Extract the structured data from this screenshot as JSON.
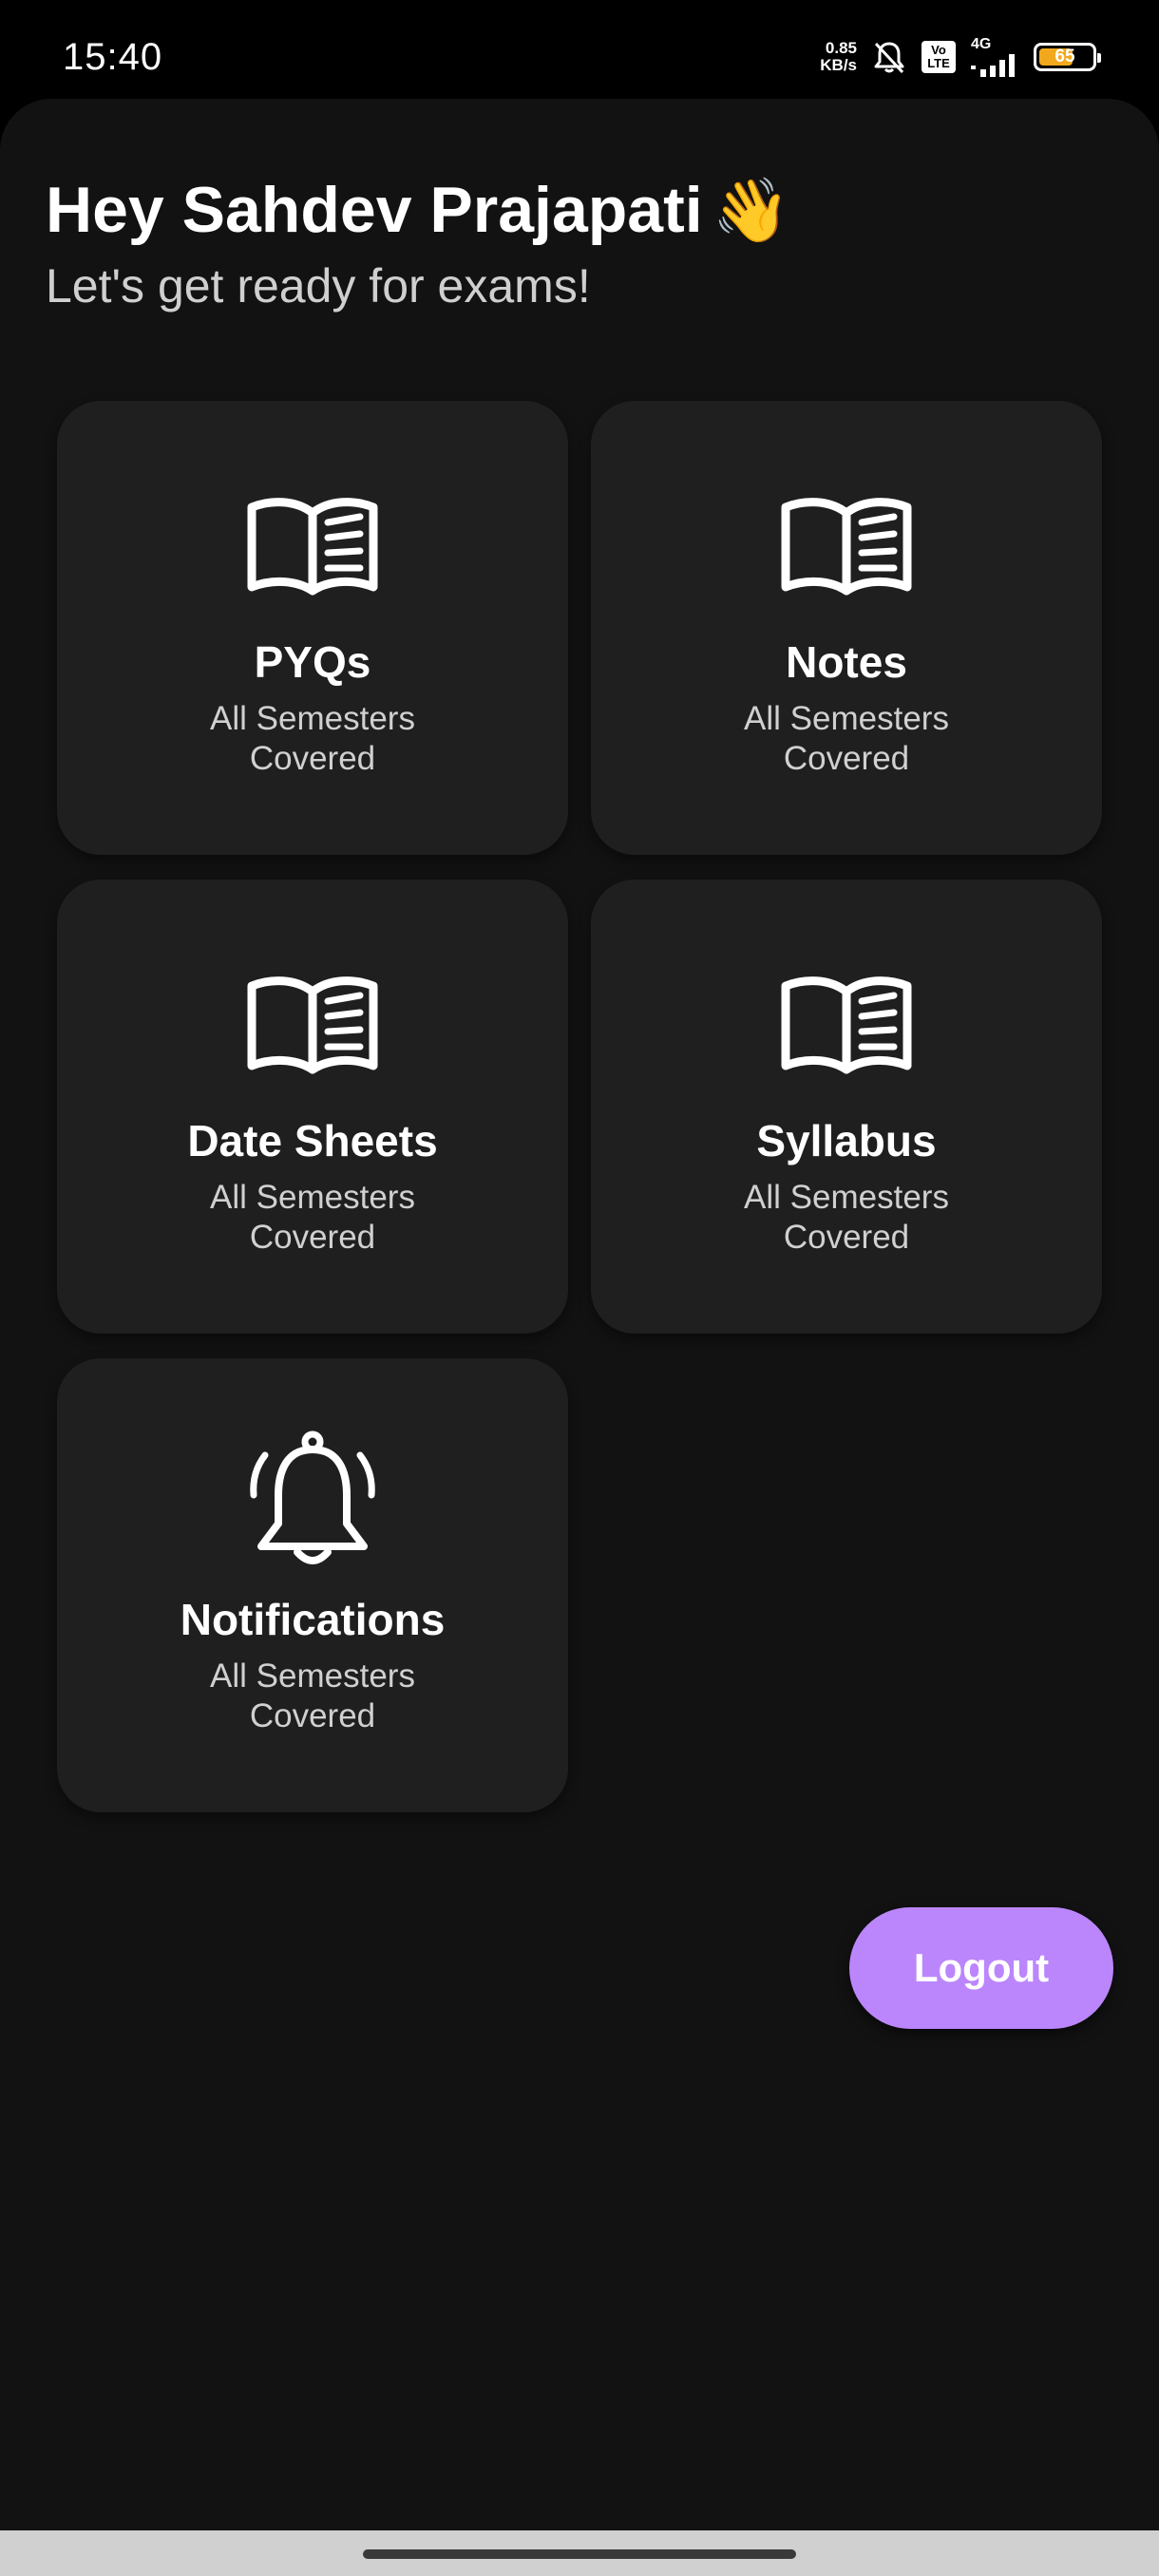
{
  "status_bar": {
    "time": "15:40",
    "net_speed_value": "0.85",
    "net_speed_unit": "KB/s",
    "volte_top": "Vo",
    "volte_bottom": "LTE",
    "network_type": "4G",
    "battery_level": "65",
    "battery_fraction": 0.65,
    "icons": [
      "bell-off-icon",
      "volte-icon",
      "signal-icon",
      "battery-icon"
    ]
  },
  "header": {
    "greeting": "Hey Sahdev Prajapati",
    "emoji": "👋",
    "subtitle": "Let's get ready for exams!"
  },
  "cards": [
    {
      "title": "PYQs",
      "subtitle": "All Semesters Covered",
      "icon": "book-icon"
    },
    {
      "title": "Notes",
      "subtitle": "All Semesters Covered",
      "icon": "book-icon"
    },
    {
      "title": "Date Sheets",
      "subtitle": "All Semesters Covered",
      "icon": "book-icon"
    },
    {
      "title": "Syllabus",
      "subtitle": "All Semesters Covered",
      "icon": "book-icon"
    },
    {
      "title": "Notifications",
      "subtitle": "All Semesters Covered",
      "icon": "bell-ringing-icon"
    }
  ],
  "logout_label": "Logout",
  "colors": {
    "background": "#121212",
    "card": "#1f1f1f",
    "accent": "#bb86fc",
    "battery": "#f2a81d"
  }
}
